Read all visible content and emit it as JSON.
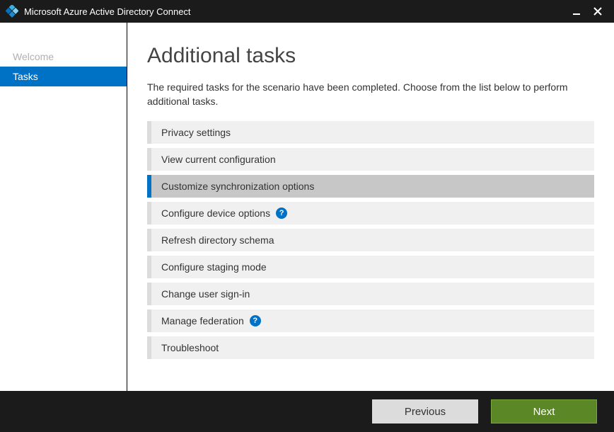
{
  "titlebar": {
    "title": "Microsoft Azure Active Directory Connect"
  },
  "sidebar": {
    "items": [
      {
        "label": "Welcome",
        "active": false
      },
      {
        "label": "Tasks",
        "active": true
      }
    ]
  },
  "main": {
    "heading": "Additional tasks",
    "description": "The required tasks for the scenario have been completed. Choose from the list below to perform additional tasks.",
    "tasks": [
      {
        "label": "Privacy settings",
        "help": false,
        "selected": false
      },
      {
        "label": "View current configuration",
        "help": false,
        "selected": false
      },
      {
        "label": "Customize synchronization options",
        "help": false,
        "selected": true
      },
      {
        "label": "Configure device options",
        "help": true,
        "selected": false
      },
      {
        "label": "Refresh directory schema",
        "help": false,
        "selected": false
      },
      {
        "label": "Configure staging mode",
        "help": false,
        "selected": false
      },
      {
        "label": "Change user sign-in",
        "help": false,
        "selected": false
      },
      {
        "label": "Manage federation",
        "help": true,
        "selected": false
      },
      {
        "label": "Troubleshoot",
        "help": false,
        "selected": false
      }
    ]
  },
  "footer": {
    "previous": "Previous",
    "next": "Next"
  }
}
